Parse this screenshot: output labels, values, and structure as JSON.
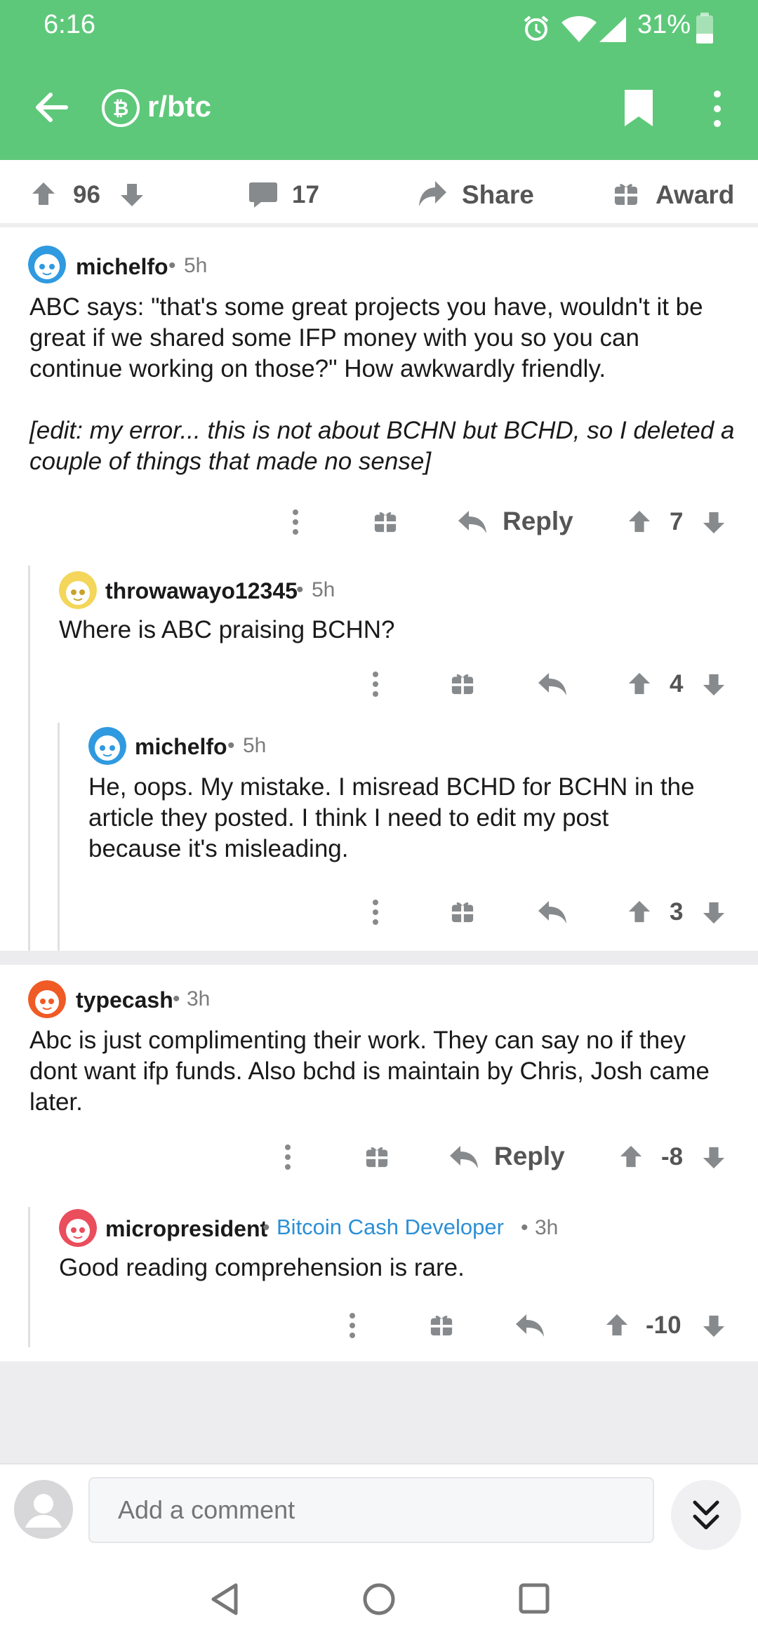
{
  "status": {
    "time": "6:16",
    "battery": "31%"
  },
  "header": {
    "subreddit": "r/btc"
  },
  "post_actions": {
    "upvotes": "96",
    "comments": "17",
    "share": "Share",
    "award": "Award"
  },
  "comments": [
    {
      "user": "michelfo",
      "age": "5h",
      "text": "ABC says: \"that's some great projects you have, wouldn't it be great if we shared some IFP money with you so you can continue working on those?\" How awkwardly friendly.",
      "edit": "[edit: my error... this is not about BCHN but BCHD, so I deleted a couple of things that made no sense]",
      "reply": "Reply",
      "score": "7"
    },
    {
      "user": "throwawayo12345",
      "age": "5h",
      "text": "Where is ABC praising BCHN?",
      "score": "4"
    },
    {
      "user": "michelfo",
      "age": "5h",
      "text": "He, oops. My mistake. I misread BCHD for BCHN in the article they posted. I think I need to edit my post because it's misleading.",
      "score": "3"
    },
    {
      "user": "typecash",
      "age": "3h",
      "text": "Abc is just complimenting their work. They can say no if they dont want ifp funds. Also bchd is maintain by Chris, Josh came later.",
      "reply": "Reply",
      "score": "-8"
    },
    {
      "user": "micropresident",
      "flair": "Bitcoin Cash Developer",
      "age": "3h",
      "text": "Good reading comprehension is rare.",
      "score": "-10"
    }
  ],
  "composer": {
    "placeholder": "Add a comment"
  },
  "colors": {
    "header": "#5ec87a",
    "flair": "#2b8fd6"
  }
}
